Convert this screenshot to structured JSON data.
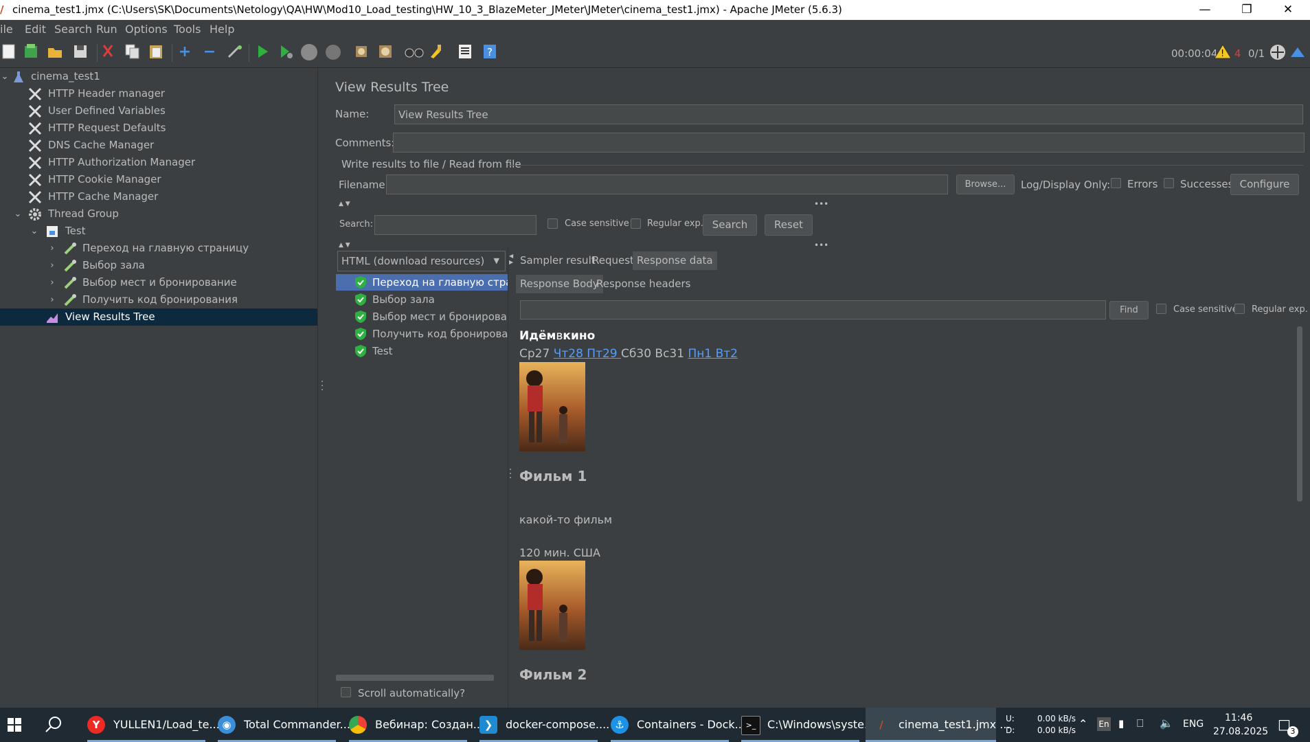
{
  "window": {
    "title": "cinema_test1.jmx (C:\\Users\\SK\\Documents\\Netology\\QA\\HW\\Mod10_Load_testing\\HW_10_3_BlazeMeter_JMeter\\JMeter\\cinema_test1.jmx) - Apache JMeter (5.6.3)",
    "controls": [
      "minimize-icon",
      "restore-icon",
      "close-icon"
    ]
  },
  "menu": [
    "ile",
    "Edit",
    "Search",
    "Run",
    "Options",
    "Tools",
    "Help"
  ],
  "toolbar": {
    "timer": "00:00:04",
    "warn_count": "4",
    "threads": "0/1"
  },
  "tree": {
    "root": "cinema_test1",
    "items": [
      "HTTP Header manager",
      "User Defined Variables",
      "HTTP Request Defaults",
      "DNS Cache Manager",
      "HTTP Authorization Manager",
      "HTTP Cookie Manager",
      "HTTP Cache Manager"
    ],
    "thread_group": "Thread Group",
    "test": "Test",
    "samplers": [
      "Переход на главную страницу",
      "Выбор зала",
      "Выбор мест и бронирование",
      "Получить код бронирования"
    ],
    "listener": "View Results Tree"
  },
  "panel": {
    "title": "View Results Tree",
    "name_label": "Name:",
    "name_value": "View Results Tree",
    "comments_label": "Comments:",
    "comments_value": "",
    "file_group": "Write results to file / Read from file",
    "filename_label": "Filename",
    "filename_value": "",
    "browse": "Browse...",
    "log_display": "Log/Display Only:",
    "errors": "Errors",
    "successes": "Successes",
    "configure": "Configure",
    "search_label": "Search:",
    "search_value": "",
    "case_sensitive": "Case sensitive",
    "regular_exp": "Regular exp.",
    "search_btn": "Search",
    "reset_btn": "Reset",
    "renderer": "HTML (download resources)",
    "scroll_auto": "Scroll automatically?"
  },
  "results": [
    "Переход на главную страни",
    "Выбор зала",
    "Выбор мест и бронировани",
    "Получить код бронировани",
    "Test"
  ],
  "tabs": [
    "Sampler result",
    "Request",
    "Response data"
  ],
  "subtabs": [
    "Response Body",
    "Response headers"
  ],
  "find": {
    "value": "",
    "btn": "Find",
    "case_sensitive": "Case sensitive",
    "regular_exp": "Regular exp."
  },
  "response": {
    "brand_a": "Идём",
    "brand_b": "в",
    "brand_c": "кино",
    "days_plain_1": "Ср27 ",
    "days_link_1": "Чт28 Пт29 ",
    "days_plain_2": "Сб30 Вс31 ",
    "days_link_2": "Пн1 Вт2 ",
    "film1": "Фильм 1",
    "desc": "какой-то фильм",
    "meta": "120 мин. США",
    "film2": "Фильм 2"
  },
  "taskbar": {
    "items": [
      "YULLEN1/Load_te...",
      "Total Commander...",
      "Вебинар: Создан...",
      "docker-compose....",
      "Containers - Dock...",
      "C:\\Windows\\syste...",
      "cinema_test1.jmx ..."
    ],
    "net_u_label": "U:",
    "net_d_label": "D:",
    "net_u": "0.00 kB/s",
    "net_d": "0.00 kB/s",
    "lang_badge": "En",
    "lang": "ENG",
    "time": "11:46",
    "date": "27.08.2025",
    "notif": "3"
  }
}
